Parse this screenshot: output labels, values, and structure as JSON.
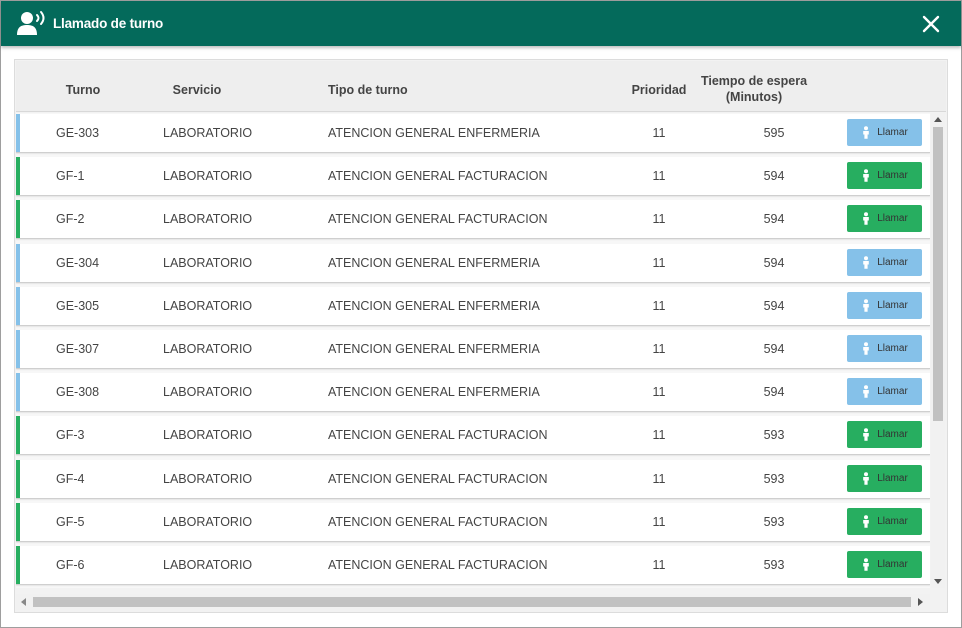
{
  "header": {
    "title": "Llamado de turno",
    "icon": "voice-call-icon",
    "background_color": "#046a5b"
  },
  "columns": {
    "turno": "Turno",
    "servicio": "Servicio",
    "tipo": "Tipo de turno",
    "prioridad": "Prioridad",
    "tiempo_line1": "Tiempo de espera",
    "tiempo_line2": "(Minutos)"
  },
  "colors": {
    "enfermeria": "#85c1e9",
    "facturacion": "#27ae60"
  },
  "rows": [
    {
      "turno": "GE-303",
      "servicio": "LABORATORIO",
      "tipo": "ATENCION GENERAL ENFERMERIA",
      "prioridad": "11",
      "tiempo": "595",
      "button": "Llamar",
      "category": "enfermeria"
    },
    {
      "turno": "GF-1",
      "servicio": "LABORATORIO",
      "tipo": "ATENCION GENERAL FACTURACION",
      "prioridad": "11",
      "tiempo": "594",
      "button": "Llamar",
      "category": "facturacion"
    },
    {
      "turno": "GF-2",
      "servicio": "LABORATORIO",
      "tipo": "ATENCION GENERAL FACTURACION",
      "prioridad": "11",
      "tiempo": "594",
      "button": "Llamar",
      "category": "facturacion"
    },
    {
      "turno": "GE-304",
      "servicio": "LABORATORIO",
      "tipo": "ATENCION GENERAL ENFERMERIA",
      "prioridad": "11",
      "tiempo": "594",
      "button": "Llamar",
      "category": "enfermeria"
    },
    {
      "turno": "GE-305",
      "servicio": "LABORATORIO",
      "tipo": "ATENCION GENERAL ENFERMERIA",
      "prioridad": "11",
      "tiempo": "594",
      "button": "Llamar",
      "category": "enfermeria"
    },
    {
      "turno": "GE-307",
      "servicio": "LABORATORIO",
      "tipo": "ATENCION GENERAL ENFERMERIA",
      "prioridad": "11",
      "tiempo": "594",
      "button": "Llamar",
      "category": "enfermeria"
    },
    {
      "turno": "GE-308",
      "servicio": "LABORATORIO",
      "tipo": "ATENCION GENERAL ENFERMERIA",
      "prioridad": "11",
      "tiempo": "594",
      "button": "Llamar",
      "category": "enfermeria"
    },
    {
      "turno": "GF-3",
      "servicio": "LABORATORIO",
      "tipo": "ATENCION GENERAL FACTURACION",
      "prioridad": "11",
      "tiempo": "593",
      "button": "Llamar",
      "category": "facturacion"
    },
    {
      "turno": "GF-4",
      "servicio": "LABORATORIO",
      "tipo": "ATENCION GENERAL FACTURACION",
      "prioridad": "11",
      "tiempo": "593",
      "button": "Llamar",
      "category": "facturacion"
    },
    {
      "turno": "GF-5",
      "servicio": "LABORATORIO",
      "tipo": "ATENCION GENERAL FACTURACION",
      "prioridad": "11",
      "tiempo": "593",
      "button": "Llamar",
      "category": "facturacion"
    },
    {
      "turno": "GF-6",
      "servicio": "LABORATORIO",
      "tipo": "ATENCION GENERAL FACTURACION",
      "prioridad": "11",
      "tiempo": "593",
      "button": "Llamar",
      "category": "facturacion"
    }
  ]
}
